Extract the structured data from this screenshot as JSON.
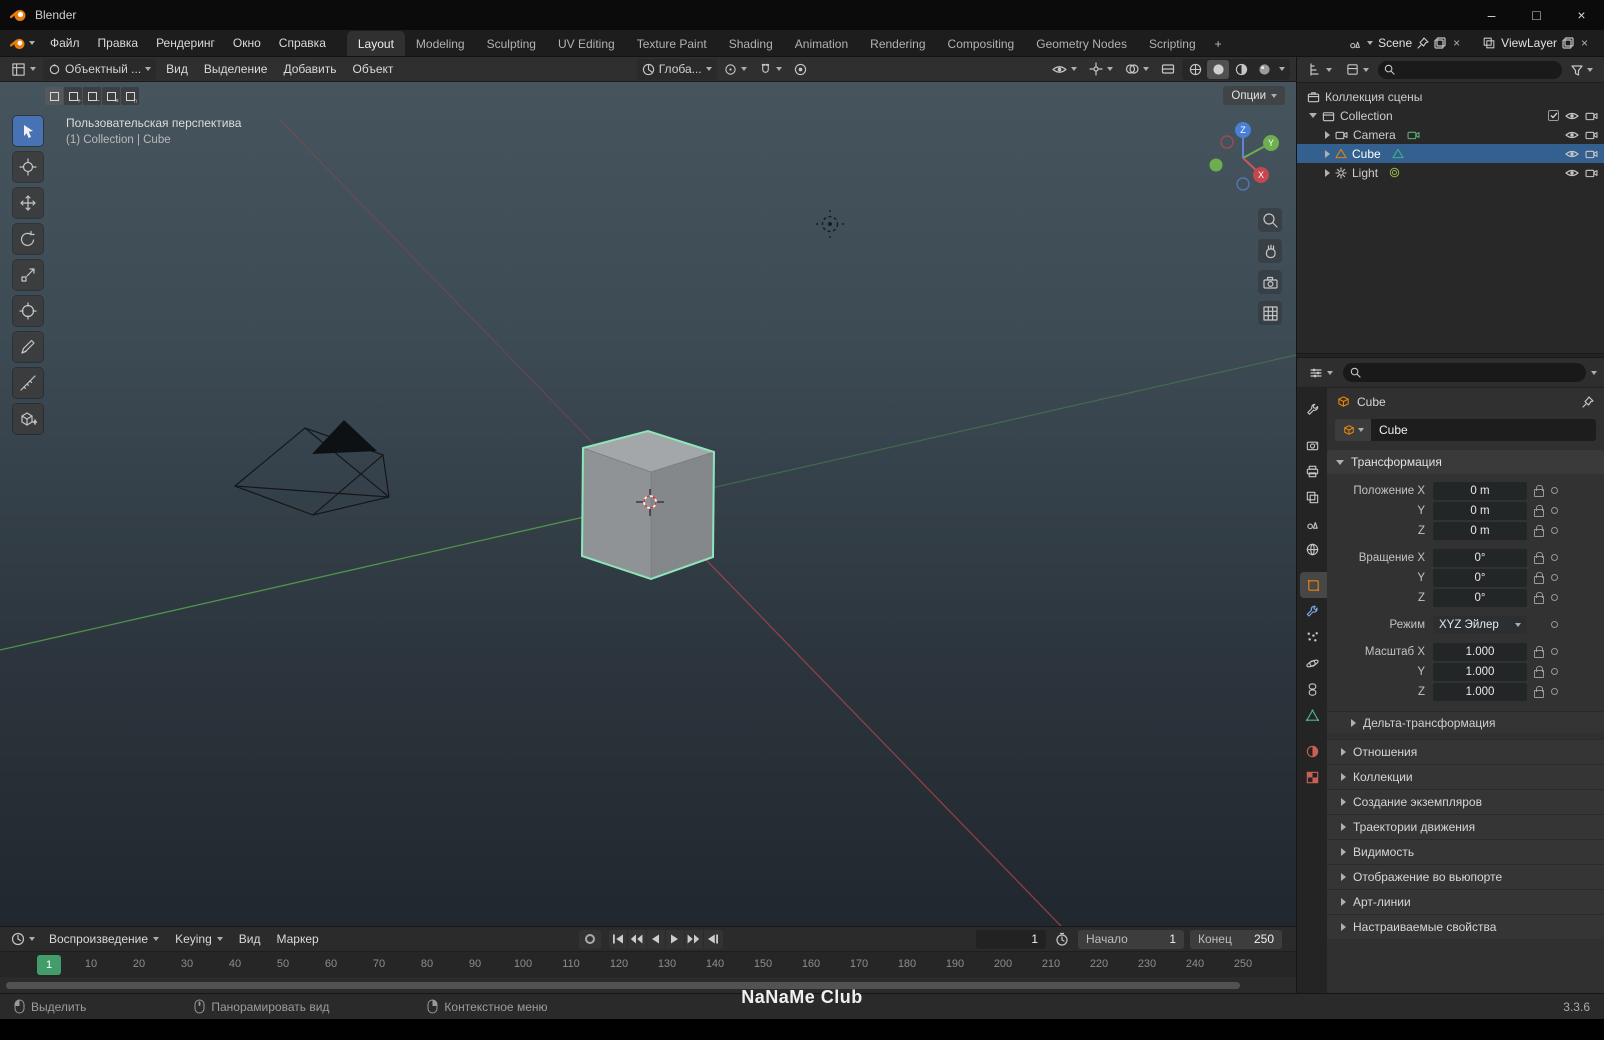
{
  "colors": {
    "accent": "#4772b3",
    "selection-outline": "#8ee6b8",
    "object-orange": "#e8840c",
    "axis-x": "#a8444c",
    "axis-y": "#56a34c",
    "playhead-green": "#439d6b"
  },
  "titlebar": {
    "app_title": "Blender",
    "minimize": "–",
    "maximize": "□",
    "close": "×"
  },
  "topbar": {
    "menus": [
      "Файл",
      "Правка",
      "Рендеринг",
      "Окно",
      "Справка"
    ],
    "tabs": [
      "Layout",
      "Modeling",
      "Sculpting",
      "UV Editing",
      "Texture Paint",
      "Shading",
      "Animation",
      "Rendering",
      "Compositing",
      "Geometry Nodes",
      "Scripting"
    ],
    "add_tab_label": "+",
    "scene_label": "Scene",
    "view_layer_label": "ViewLayer"
  },
  "viewport_header": {
    "mode_label": "Объектный ...",
    "menus": [
      "Вид",
      "Выделение",
      "Добавить",
      "Объект"
    ],
    "orientation_label": "Глоба..."
  },
  "viewport": {
    "options_label": "Опции",
    "overlay_line1": "Пользовательская перспектива",
    "overlay_line2": "(1) Collection | Cube",
    "axis_x": "X",
    "axis_y": "Y",
    "axis_z": "Z",
    "tools": [
      "box-select",
      "cursor",
      "move",
      "rotate",
      "scale",
      "transform",
      "annotate",
      "measure",
      "add-cube"
    ]
  },
  "outliner": {
    "scene_collection_label": "Коллекция сцены",
    "collection_label": "Collection",
    "objects": [
      "Camera",
      "Cube",
      "Light"
    ]
  },
  "properties": {
    "breadcrumb": "Cube",
    "name_value": "Cube",
    "transform_title": "Трансформация",
    "rows": {
      "loc_x": {
        "label": "Положение X",
        "value": "0 m"
      },
      "loc_y": {
        "label": "Y",
        "value": "0 m"
      },
      "loc_z": {
        "label": "Z",
        "value": "0 m"
      },
      "rot_x": {
        "label": "Вращение X",
        "value": "0°"
      },
      "rot_y": {
        "label": "Y",
        "value": "0°"
      },
      "rot_z": {
        "label": "Z",
        "value": "0°"
      },
      "mode": {
        "label": "Режим",
        "value": "XYZ Эйлер"
      },
      "scl_x": {
        "label": "Масштаб X",
        "value": "1.000"
      },
      "scl_y": {
        "label": "Y",
        "value": "1.000"
      },
      "scl_z": {
        "label": "Z",
        "value": "1.000"
      }
    },
    "subpanel": "Дельта-трансформация",
    "sections": [
      "Отношения",
      "Коллекции",
      "Создание экземпляров",
      "Траектории движения",
      "Видимость",
      "Отображение во вьюпорте",
      "Арт-линии",
      "Настраиваемые свойства"
    ]
  },
  "timeline": {
    "menus": [
      "Воспроизведение",
      "Keying",
      "Вид",
      "Маркер"
    ],
    "frame_value": "1",
    "start_label": "Начало",
    "start_value": "1",
    "end_label": "Конец",
    "end_value": "250",
    "playhead_label": "1",
    "ticks": [
      "10",
      "20",
      "30",
      "40",
      "50",
      "60",
      "70",
      "80",
      "90",
      "100",
      "110",
      "120",
      "130",
      "140",
      "150",
      "160",
      "170",
      "180",
      "190",
      "200",
      "210",
      "220",
      "230",
      "240",
      "250"
    ]
  },
  "statusbar": {
    "left_items": [
      "Выделить",
      "Панорамировать вид",
      "Контекстное меню"
    ],
    "watermark": "NaNaMe Club",
    "version": "3.3.6"
  }
}
